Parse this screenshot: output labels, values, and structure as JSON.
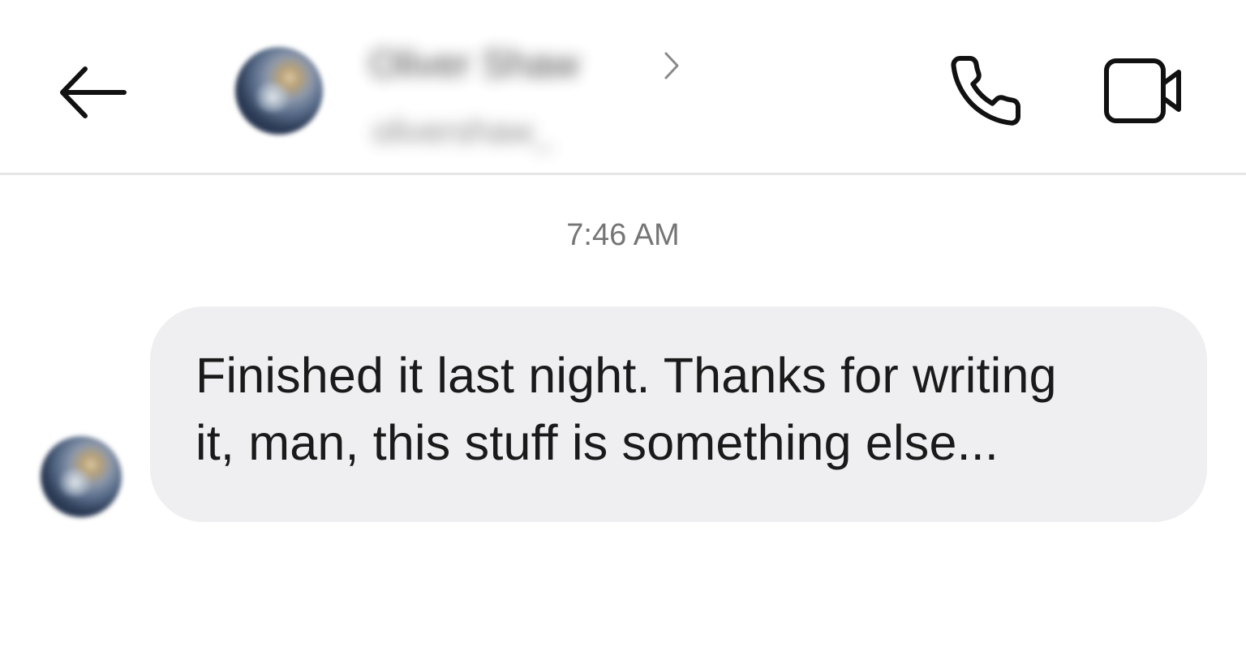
{
  "header": {
    "contact_name": "Oliver Shaw",
    "contact_handle": "olivershaw_",
    "icons": {
      "back": "arrow-left-icon",
      "chevron": "chevron-right-icon",
      "call": "phone-icon",
      "video": "video-camera-icon"
    }
  },
  "conversation": {
    "timestamp": "7:46 AM",
    "messages": [
      {
        "sender": "contact",
        "text": "Finished it last night. Thanks for writing\nit, man, this stuff is something else..."
      }
    ]
  },
  "colors": {
    "bubble_background": "#efeff1",
    "icon_stroke": "#111111",
    "timestamp_text": "#757575",
    "divider": "#e6e6e6"
  }
}
